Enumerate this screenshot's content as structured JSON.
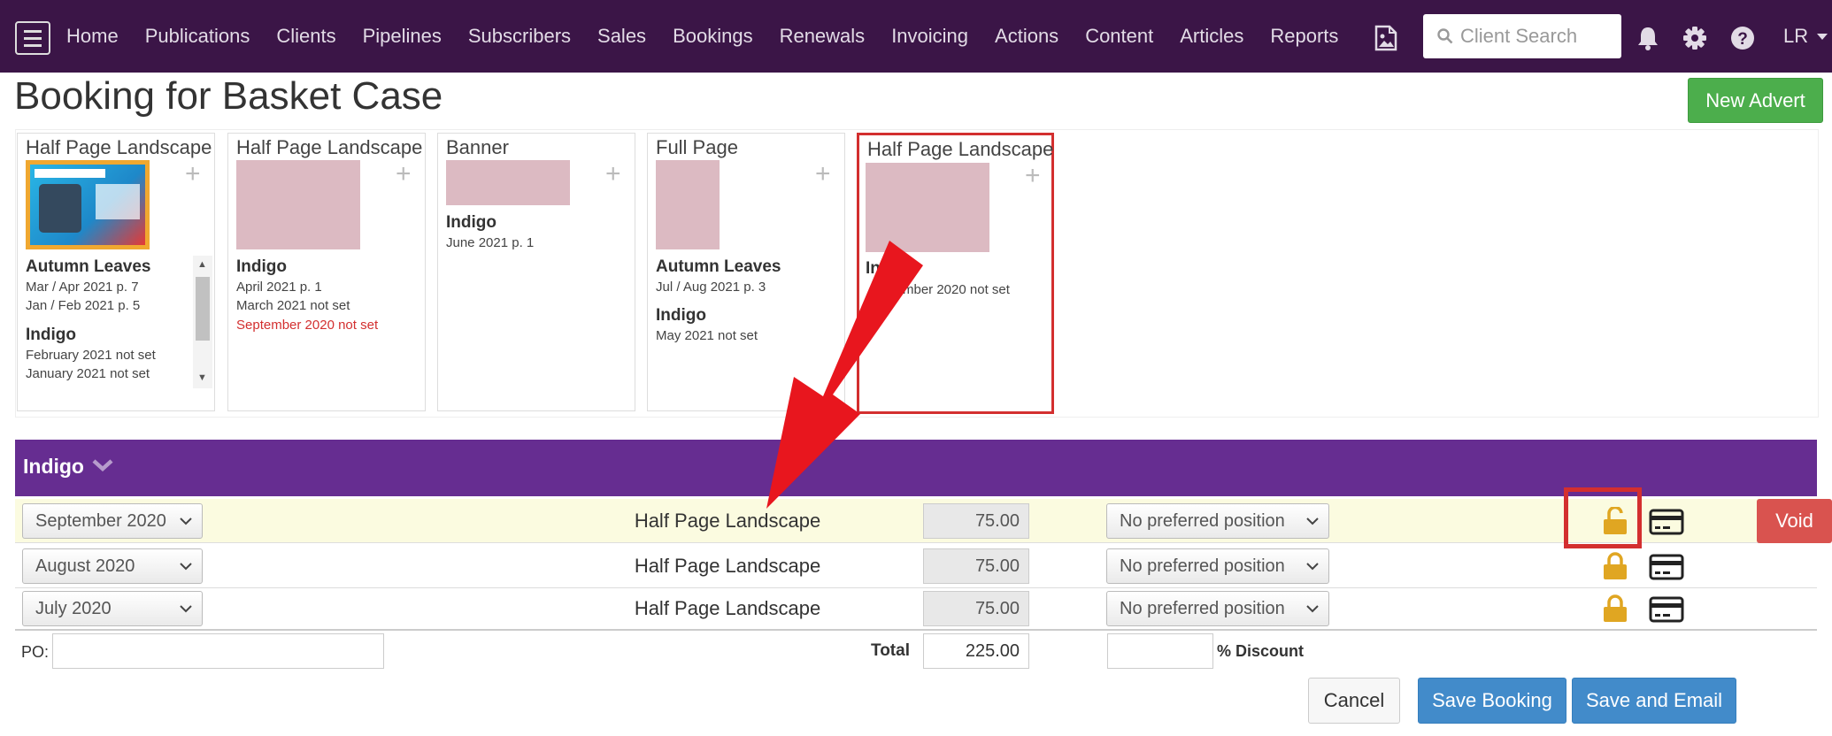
{
  "nav": {
    "links": [
      "Home",
      "Publications",
      "Clients",
      "Pipelines",
      "Subscribers",
      "Sales",
      "Bookings",
      "Renewals",
      "Invoicing",
      "Actions",
      "Content",
      "Articles",
      "Reports"
    ],
    "search_placeholder": "Client Search",
    "user": "LR"
  },
  "page": {
    "title": "Booking for Basket Case",
    "new_advert": "New Advert"
  },
  "cards": [
    {
      "title": "Half Page Landscape",
      "thumbnail": "window-cleaning-ad",
      "publications": [
        {
          "name": "Autumn Leaves",
          "issues": [
            "Mar / Apr 2021 p. 7",
            "Jan / Feb 2021 p. 5"
          ]
        },
        {
          "name": "Indigo",
          "issues": [
            "February 2021 not set",
            "January 2021 not set"
          ]
        }
      ]
    },
    {
      "title": "Half Page Landscape",
      "publications": [
        {
          "name": "Indigo",
          "issues": [
            "April 2021 p. 1",
            "March 2021 not set"
          ],
          "issue_red": "September 2020 not set"
        }
      ]
    },
    {
      "title": "Banner",
      "publications": [
        {
          "name": "Indigo",
          "issues": [
            "June 2021 p. 1"
          ]
        }
      ]
    },
    {
      "title": "Full Page",
      "publications": [
        {
          "name": "Autumn Leaves",
          "issues": [
            "Jul / Aug 2021 p. 3"
          ]
        },
        {
          "name": "Indigo",
          "issues": [
            "May 2021 not set"
          ]
        }
      ]
    },
    {
      "title": "Half Page Landscape",
      "publications": [
        {
          "name": "In",
          "issues": [
            "mber 2020 not set"
          ]
        }
      ]
    }
  ],
  "booking": {
    "group": "Indigo",
    "rows": [
      {
        "month": "September 2020",
        "ad_type": "Half Page Landscape",
        "price": "75.00",
        "position": "No preferred position",
        "lock": "unlocked",
        "void": "Void"
      },
      {
        "month": "August 2020",
        "ad_type": "Half Page Landscape",
        "price": "75.00",
        "position": "No preferred position",
        "lock": "locked"
      },
      {
        "month": "July 2020",
        "ad_type": "Half Page Landscape",
        "price": "75.00",
        "position": "No preferred position",
        "lock": "locked"
      }
    ],
    "po_label": "PO:",
    "total_label": "Total",
    "total": "225.00",
    "discount_label": "% Discount"
  },
  "buttons": {
    "cancel": "Cancel",
    "save": "Save Booking",
    "save_email": "Save and Email"
  },
  "colors": {
    "navbar": "#3b1547",
    "group_header": "#662d91",
    "thumb_placeholder": "#dcbac2",
    "success": "#4cae4c",
    "danger": "#d9534f",
    "primary": "#428bca",
    "annotation": "#e8161e",
    "lock": "#e0a622"
  }
}
